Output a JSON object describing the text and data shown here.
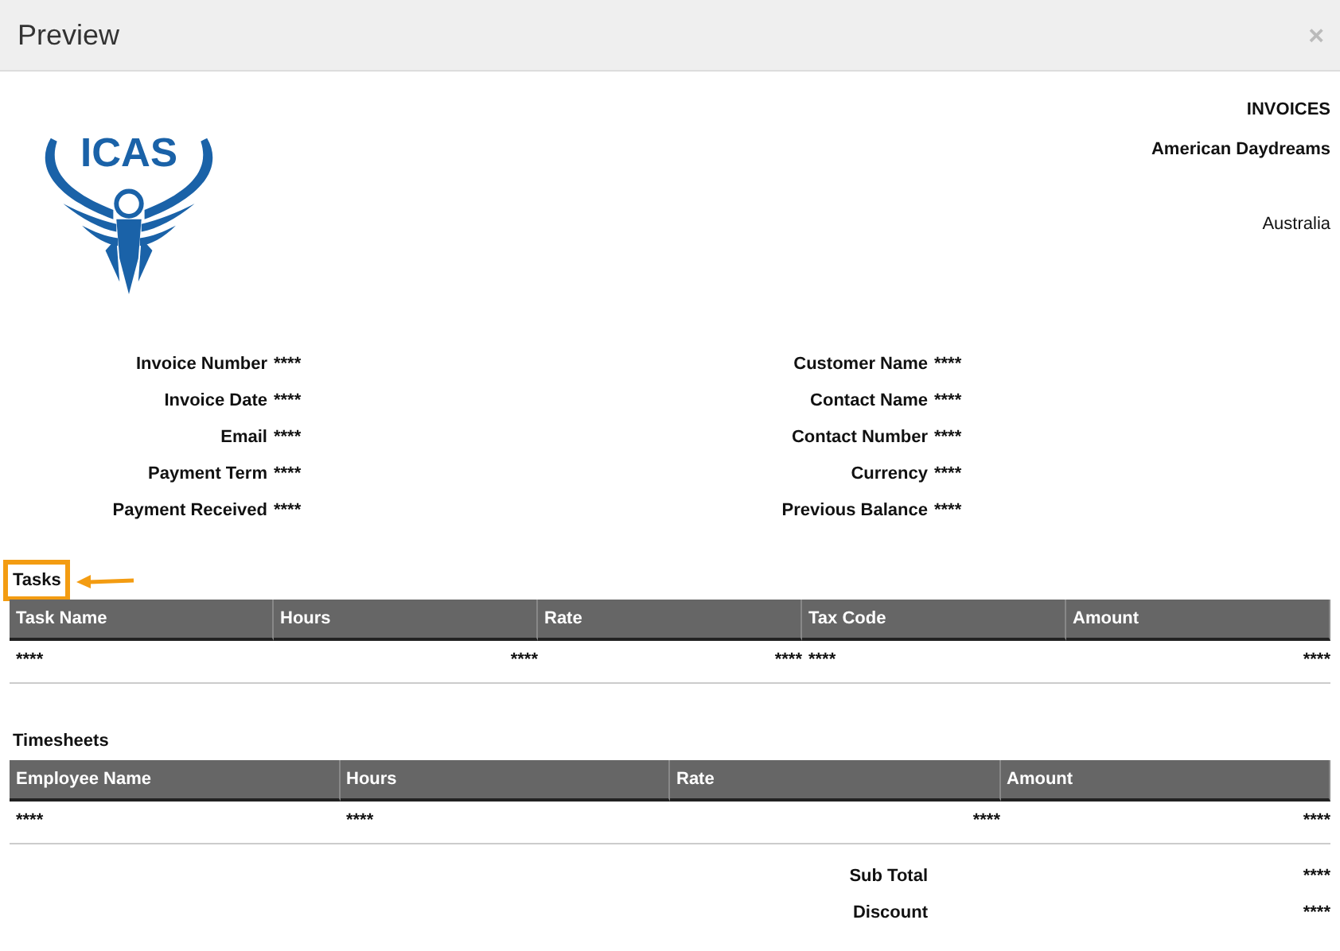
{
  "window": {
    "title": "Preview",
    "close": "×"
  },
  "logo": {
    "text": "ICAS"
  },
  "header": {
    "doc_type": "INVOICES",
    "company": "American Daydreams",
    "country": "Australia"
  },
  "fields": [
    {
      "label": "Invoice Number",
      "value": "****"
    },
    {
      "label": "Customer Name",
      "value": "****"
    },
    {
      "label": "Invoice Date",
      "value": "****"
    },
    {
      "label": "Contact Name",
      "value": "****"
    },
    {
      "label": "Email",
      "value": "****"
    },
    {
      "label": "Contact Number",
      "value": "****"
    },
    {
      "label": "Payment Term",
      "value": "****"
    },
    {
      "label": "Currency",
      "value": "****"
    },
    {
      "label": "Payment Received",
      "value": "****"
    },
    {
      "label": "Previous Balance",
      "value": "****"
    }
  ],
  "tables": [
    {
      "title": "Tasks",
      "highlighted": true,
      "columns": [
        "Task Name",
        "Hours",
        "Rate",
        "Tax Code",
        "Amount"
      ],
      "rows": [
        [
          "****",
          "****",
          "****",
          "****",
          "****"
        ]
      ]
    },
    {
      "title": "Timesheets",
      "highlighted": false,
      "columns": [
        "Employee Name",
        "Hours",
        "Rate",
        "Amount"
      ],
      "rows": [
        [
          "****",
          "****",
          "****",
          "****"
        ]
      ]
    }
  ],
  "totals": [
    {
      "label": "Sub Total",
      "value": "****"
    },
    {
      "label": "Discount",
      "value": "****"
    }
  ]
}
